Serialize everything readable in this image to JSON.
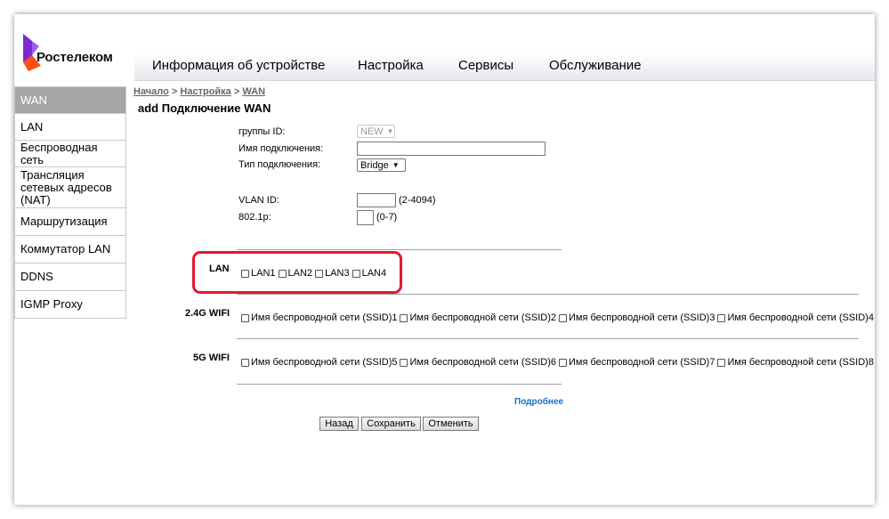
{
  "brand": {
    "name": "Ростелеком",
    "accent": "#7b2bd6",
    "accent2": "#ff4f12"
  },
  "topnav": [
    {
      "label": "Информация об устройстве"
    },
    {
      "label": "Настройка"
    },
    {
      "label": "Сервисы"
    },
    {
      "label": "Обслуживание"
    }
  ],
  "sidebar": [
    {
      "label": "WAN",
      "active": true
    },
    {
      "label": "LAN"
    },
    {
      "label": "Беспроводная сеть"
    },
    {
      "label": "Трансляция сетевых адресов (NAT)"
    },
    {
      "label": "Маршрутизация"
    },
    {
      "label": "Коммутатор LAN"
    },
    {
      "label": "DDNS"
    },
    {
      "label": "IGMP Proxy"
    }
  ],
  "breadcrumb": {
    "home": "Начало",
    "sep": " > ",
    "settings": "Настройка",
    "current": "WAN"
  },
  "page_title": "add Подключение WAN",
  "form": {
    "group_id_label": "группы ID:",
    "group_id_value": "NEW",
    "conn_name_label": "Имя подключения:",
    "conn_name_value": "",
    "conn_type_label": "Тип подключения:",
    "conn_type_value": "Bridge",
    "vlan_label": "VLAN ID:",
    "vlan_value": "",
    "vlan_range": "(2-4094)",
    "dot1p_label": "802.1p:",
    "dot1p_value": "",
    "dot1p_range": "(0-7)"
  },
  "lan": {
    "label": "LAN",
    "ports": [
      "LAN1",
      "LAN2",
      "LAN3",
      "LAN4"
    ]
  },
  "wifi24": {
    "label": "2.4G WIFI",
    "ssids": [
      "Имя беспроводной сети (SSID)1",
      "Имя беспроводной сети (SSID)2",
      "Имя беспроводной сети (SSID)3",
      "Имя беспроводной сети (SSID)4"
    ]
  },
  "wifi5": {
    "label": "5G WIFI",
    "ssids": [
      "Имя беспроводной сети (SSID)5",
      "Имя беспроводной сети (SSID)6",
      "Имя беспроводной сети (SSID)7",
      "Имя беспроводной сети (SSID)8"
    ]
  },
  "more_link": "Подробнее",
  "buttons": {
    "back": "Назад",
    "save": "Сохранить",
    "cancel": "Отменить"
  }
}
